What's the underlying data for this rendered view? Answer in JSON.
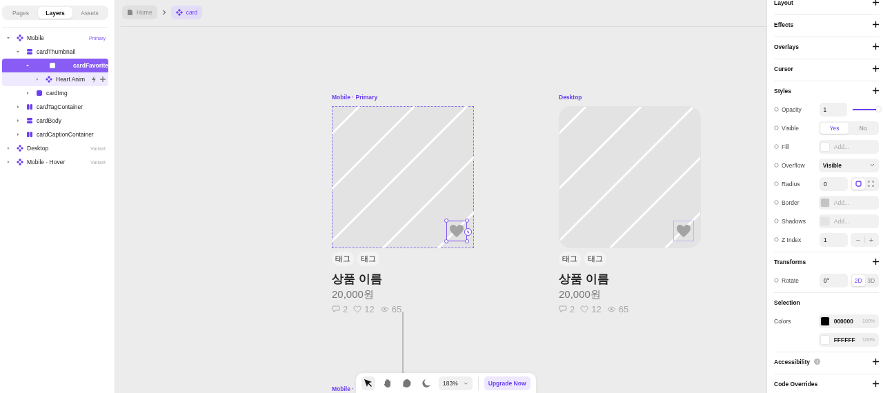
{
  "sidebar": {
    "tabs": [
      {
        "label": "Pages",
        "selected": false
      },
      {
        "label": "Layers",
        "selected": true
      },
      {
        "label": "Assets",
        "selected": false
      }
    ],
    "layers": [
      {
        "name": "Mobile",
        "kind": "component",
        "badge": "Primary",
        "selected": false,
        "children": [
          {
            "name": "cardThumbnail",
            "kind": "stack",
            "selected": false,
            "children": [
              {
                "name": "cardFavorite",
                "kind": "frame",
                "selected": true,
                "children": [
                  {
                    "name": "Heart Anim",
                    "kind": "component",
                    "selected": false,
                    "actions": true
                  }
                ]
              },
              {
                "name": "cardImg",
                "kind": "frame",
                "selected": false
              }
            ]
          },
          {
            "name": "cardTagContainer",
            "kind": "row",
            "selected": false
          },
          {
            "name": "cardBody",
            "kind": "stack",
            "selected": false
          },
          {
            "name": "cardCaptionContainer",
            "kind": "row",
            "selected": false
          }
        ]
      },
      {
        "name": "Desktop",
        "kind": "component",
        "badge": "Variant",
        "selected": false
      },
      {
        "name": "Mobile · Hover",
        "kind": "component",
        "badge": "Variant",
        "selected": false
      }
    ]
  },
  "breadcrumb": [
    {
      "label": "Home",
      "kind": "page",
      "selected": false
    },
    {
      "label": "card",
      "kind": "component",
      "selected": true
    }
  ],
  "frames": [
    {
      "label": "Mobile · Primary",
      "kind": "mobile",
      "selected": true,
      "tags": [
        "태그",
        "태그"
      ],
      "title": "상품 이름",
      "price": "20,000원",
      "stats": [
        {
          "kind": "comment",
          "value": "2"
        },
        {
          "kind": "like",
          "value": "12"
        },
        {
          "kind": "view",
          "value": "65"
        }
      ]
    },
    {
      "label": "Desktop",
      "kind": "desktop",
      "selected": false,
      "tags": [
        "태그",
        "태그"
      ],
      "title": "상품 이름",
      "price": "20,000원",
      "stats": [
        {
          "kind": "comment",
          "value": "2"
        },
        {
          "kind": "like",
          "value": "12"
        },
        {
          "kind": "view",
          "value": "65"
        }
      ]
    }
  ],
  "hidden_frame_label": "Mobile ·",
  "toolbar": {
    "tools": [
      {
        "kind": "pointer",
        "selected": true
      },
      {
        "kind": "hand",
        "selected": false
      },
      {
        "kind": "comment",
        "selected": false
      },
      {
        "kind": "theme",
        "selected": false
      }
    ],
    "zoom": "183%",
    "upgrade": "Upgrade Now"
  },
  "properties": [
    {
      "title": "Layout",
      "addable": true
    },
    {
      "title": "Effects",
      "addable": true
    },
    {
      "title": "Overlays",
      "addable": true
    },
    {
      "title": "Cursor",
      "addable": true
    },
    {
      "title": "Styles",
      "addable": true,
      "rows": [
        {
          "label": "Opacity",
          "kind": "slider",
          "value": "1",
          "level": 1
        },
        {
          "label": "Visible",
          "kind": "segmented",
          "options": [
            {
              "label": "Yes",
              "selected": true
            },
            {
              "label": "No",
              "selected": false
            }
          ]
        },
        {
          "label": "Fill",
          "kind": "add",
          "placeholder": "Add...",
          "color": "#ffffff"
        },
        {
          "label": "Overflow",
          "kind": "select",
          "value": "Visible"
        },
        {
          "label": "Radius",
          "kind": "radius",
          "value": "0",
          "options": [
            {
              "kind": "uniform",
              "selected": true
            },
            {
              "kind": "individual",
              "selected": false
            }
          ]
        },
        {
          "label": "Border",
          "kind": "add",
          "placeholder": "Add...",
          "color": "#c4c4c4"
        },
        {
          "label": "Shadows",
          "kind": "add",
          "placeholder": "Add...",
          "color": "#e4e4e4"
        },
        {
          "label": "Z Index",
          "kind": "stepper",
          "value": "1",
          "minus": "−",
          "plus": "+"
        }
      ]
    },
    {
      "title": "Transforms",
      "addable": true,
      "rows": [
        {
          "label": "Rotate",
          "kind": "value_segmented",
          "value": "0°",
          "options": [
            {
              "label": "2D",
              "selected": true
            },
            {
              "label": "3D",
              "selected": false
            }
          ]
        }
      ]
    },
    {
      "title": "Selection",
      "addable": false,
      "rows": [
        {
          "label": "Colors",
          "kind": "color",
          "hex": "000000",
          "opacity": "100%"
        },
        {
          "kind": "color",
          "hex": "FFFFFF",
          "opacity": "100%"
        }
      ]
    },
    {
      "title": "Accessibility",
      "addable": true,
      "info": true
    },
    {
      "title": "Code Overrides",
      "addable": true
    }
  ]
}
